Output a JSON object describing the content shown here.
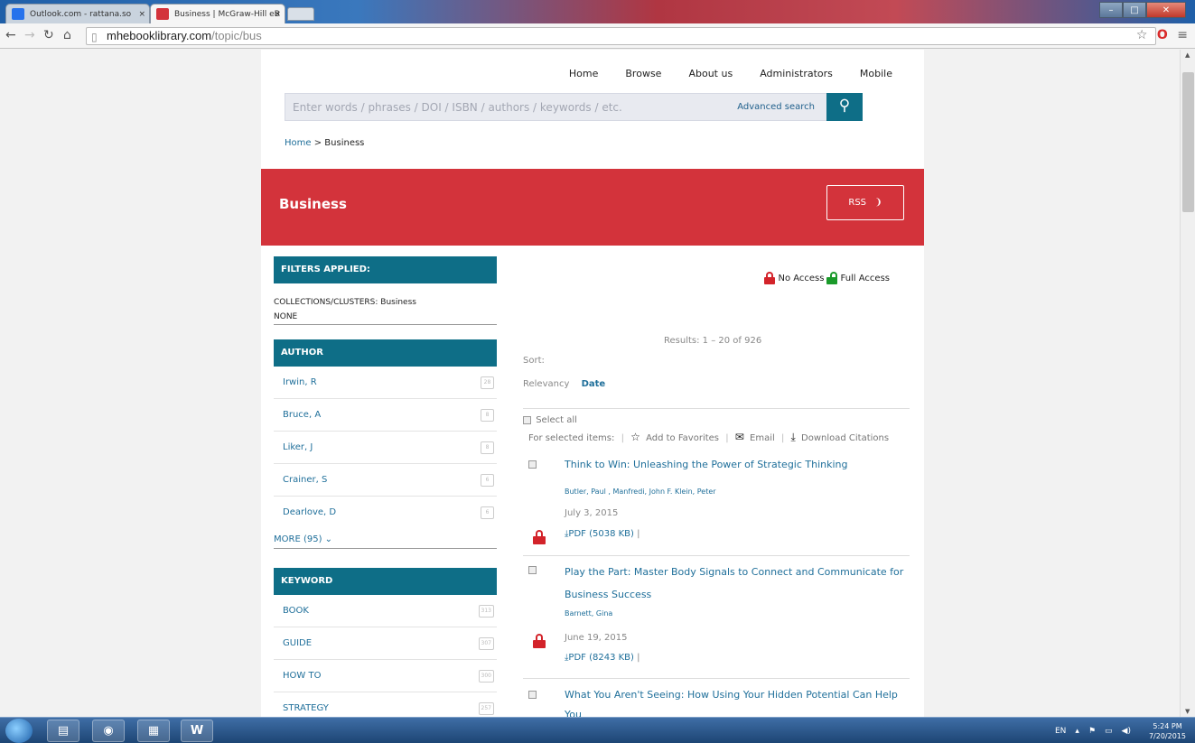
{
  "browser": {
    "tabs": [
      {
        "label": "Outlook.com - rattana.so",
        "favicon_color": "#2672ec"
      },
      {
        "label": "Business | McGraw-Hill eB",
        "favicon_color": "#d3333b"
      }
    ],
    "tab_close": "×",
    "url_domain": "mhebooklibrary.com",
    "url_path": "/topic/bus"
  },
  "nav": {
    "items": [
      "Home",
      "Browse",
      "About us",
      "Administrators",
      "Mobile"
    ]
  },
  "search": {
    "placeholder": "Enter words / phrases / DOI / ISBN / authors / keywords / etc.",
    "advanced_label": "Advanced search"
  },
  "breadcrumb": {
    "home": "Home",
    "separator": ">",
    "current": "Business"
  },
  "banner": {
    "title": "Business",
    "rss_label": "RSS",
    "color": "#d3333b"
  },
  "filters": {
    "heading": "FILTERS APPLIED:",
    "collections": "COLLECTIONS/CLUSTERS: Business",
    "none": "NONE"
  },
  "author_facet": {
    "heading": "AUTHOR",
    "items": [
      {
        "label": "Irwin, R",
        "count": "28"
      },
      {
        "label": "Bruce, A",
        "count": "8"
      },
      {
        "label": "Liker, J",
        "count": "8"
      },
      {
        "label": "Crainer, S",
        "count": "6"
      },
      {
        "label": "Dearlove, D",
        "count": "6"
      }
    ],
    "more": "MORE (95)"
  },
  "keyword_facet": {
    "heading": "KEYWORD",
    "items": [
      {
        "label": "BOOK",
        "count": "313"
      },
      {
        "label": "GUIDE",
        "count": "307"
      },
      {
        "label": "HOW TO",
        "count": "300"
      },
      {
        "label": "STRATEGY",
        "count": "257"
      }
    ]
  },
  "access_legend": {
    "no_access": "No Access",
    "full_access": "Full Access"
  },
  "results": {
    "count_text": "Results: 1 – 20 of 926",
    "sort_label": "Sort:",
    "sort_relevancy": "Relevancy",
    "sort_date": "Date",
    "select_all": "Select all",
    "for_selected": "For selected items:",
    "add_favorites": "Add to Favorites",
    "email": "Email",
    "download_citations": "Download Citations",
    "items": [
      {
        "title": "Think to Win: Unleashing the Power of Strategic Thinking",
        "authors": "Butler, Paul ,  Manfredi, John F. Klein, Peter",
        "date": "July 3, 2015",
        "pdf": "PDF (5038 KB)"
      },
      {
        "title": "Play the Part: Master Body Signals to Connect and Communicate for Business Success",
        "authors": "Barnett, Gina",
        "date": "June 19, 2015",
        "pdf": "PDF (8243 KB)"
      },
      {
        "title": "What You Aren't Seeing: How Using Your Hidden Potential Can Help You"
      }
    ]
  },
  "taskbar": {
    "apps": [
      "explorer",
      "chrome",
      "excel",
      "word"
    ],
    "word_glyph": "W",
    "language": "EN",
    "time": "5:24 PM",
    "date": "7/20/2015"
  },
  "colors": {
    "teal": "#0e6e87",
    "link": "#1f6f9a"
  }
}
